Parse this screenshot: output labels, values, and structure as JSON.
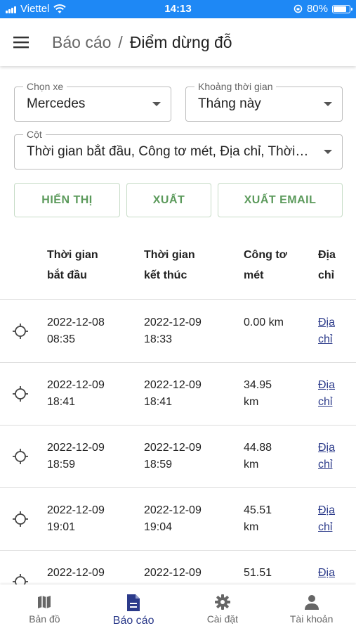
{
  "status_bar": {
    "carrier": "Viettel",
    "time": "14:13",
    "battery": "80%"
  },
  "header": {
    "breadcrumb": "Báo cáo",
    "separator": "/",
    "title": "Điểm dừng đỗ"
  },
  "filters": {
    "vehicle": {
      "label": "Chọn xe",
      "value": "Mercedes"
    },
    "period": {
      "label": "Khoảng thời gian",
      "value": "Tháng này"
    },
    "columns": {
      "label": "Cột",
      "value": "Thời gian bắt đầu, Công tơ mét, Địa chỉ, Thời…"
    }
  },
  "buttons": {
    "show": "HIỂN THỊ",
    "export": "XUẤT",
    "export_email": "XUẤT EMAIL"
  },
  "table": {
    "headers": {
      "start_line1": "Thời gian",
      "start_line2": "bắt đầu",
      "end_line1": "Thời gian",
      "end_line2": "kết thúc",
      "odo_line1": "Công tơ",
      "odo_line2": "mét",
      "addr_line1": "Địa",
      "addr_line2": "chỉ"
    },
    "rows": [
      {
        "start_date": "2022-12-08",
        "start_time": "08:35",
        "end_date": "2022-12-09",
        "end_time": "18:33",
        "odo_line1": "0.00 km",
        "odo_line2": "",
        "addr_line1": "Địa",
        "addr_line2": "chỉ"
      },
      {
        "start_date": "2022-12-09",
        "start_time": "18:41",
        "end_date": "2022-12-09",
        "end_time": "18:41",
        "odo_line1": "34.95",
        "odo_line2": "km",
        "addr_line1": "Địa",
        "addr_line2": "chỉ"
      },
      {
        "start_date": "2022-12-09",
        "start_time": "18:59",
        "end_date": "2022-12-09",
        "end_time": "18:59",
        "odo_line1": "44.88",
        "odo_line2": "km",
        "addr_line1": "Địa",
        "addr_line2": "chỉ"
      },
      {
        "start_date": "2022-12-09",
        "start_time": "19:01",
        "end_date": "2022-12-09",
        "end_time": "19:04",
        "odo_line1": "45.51",
        "odo_line2": "km",
        "addr_line1": "Địa",
        "addr_line2": "chỉ"
      },
      {
        "start_date": "2022-12-09",
        "start_time": "",
        "end_date": "2022-12-09",
        "end_time": "",
        "odo_line1": "51.51",
        "odo_line2": "",
        "addr_line1": "Địa",
        "addr_line2": ""
      }
    ]
  },
  "bottom_nav": {
    "map": "Bản đồ",
    "reports": "Báo cáo",
    "settings": "Cài đặt",
    "account": "Tài khoản"
  },
  "colors": {
    "status_bar": "#1e88f5",
    "accent": "#2b3a8a",
    "button_text": "#5b9a5b"
  }
}
